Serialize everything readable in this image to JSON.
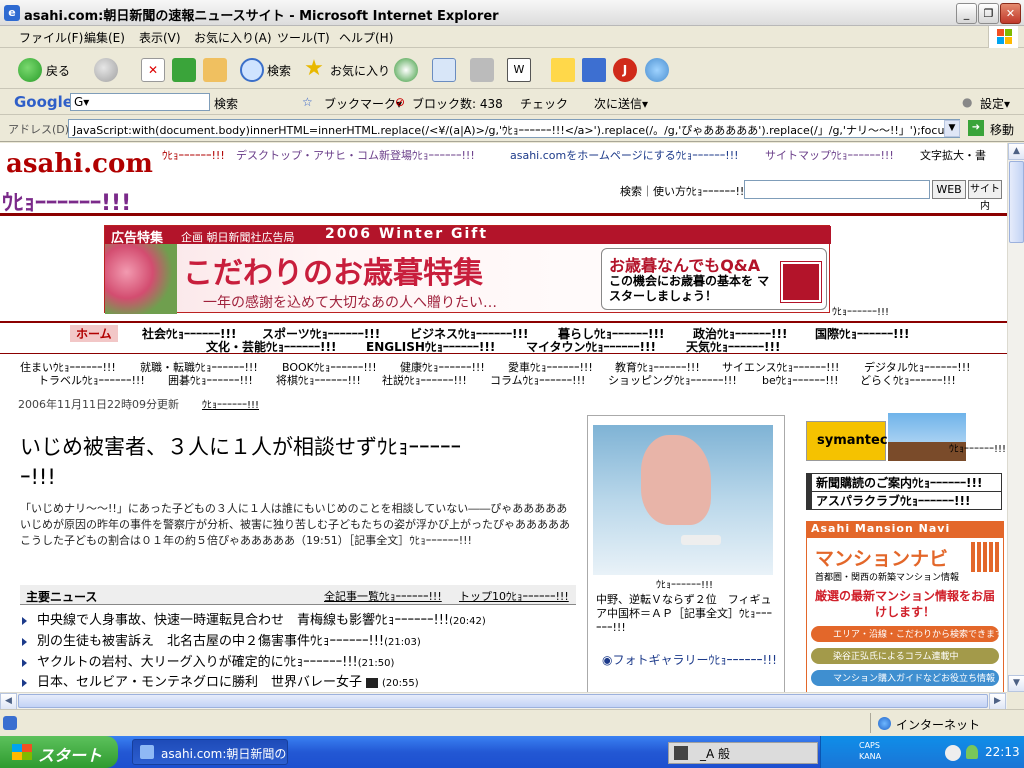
{
  "window": {
    "title": "asahi.com:朝日新聞の速報ニュースサイト - Microsoft Internet Explorer",
    "buttons": {
      "minimize": "_",
      "restore": "❐",
      "close": "✕"
    }
  },
  "menu": [
    "ファイル(F)",
    "編集(E)",
    "表示(V)",
    "お気に入り(A)",
    "ツール(T)",
    "ヘルプ(H)"
  ],
  "toolbar": {
    "back": "戻る",
    "search": "検索",
    "favorites": "お気に入り"
  },
  "google": {
    "logo": "Google",
    "input": "G▾",
    "search": "検索",
    "bookmark": "ブックマーク▾",
    "block": "ブロック数: 438",
    "check": "チェック",
    "send": "次に送信▾",
    "settings": "設定▾"
  },
  "address": {
    "label": "アドレス(D)",
    "url": "JavaScript:with(document.body)innerHTML=innerHTML.replace(/<¥/(a|A)>/g,'ｳﾋｮｰｰｰｰｰｰ!!!</a>').replace(/。/g,'ぴゃあああああ').replace(/」/g,'ナリ～～!!」');focus()",
    "go": "移動"
  },
  "site": {
    "logo": "asahi.com",
    "tagline": "ｳﾋｮｰｰｰｰｰｰ!!!",
    "topnav": [
      "ｳﾋｮｰｰｰｰｰｰ!!!",
      "デスクトップ・アサヒ・コム新登場ｳﾋｮｰｰｰｰｰｰ!!!",
      "asahi.comをホームページにするｳﾋｮｰｰｰｰｰｰ!!!",
      "サイトマップｳﾋｮｰｰｰｰｰｰ!!!",
      "文字拡大・書"
    ],
    "search_label": "検索｜使い方ｳﾋｮｰｰｰｰｰｰ!!!",
    "web_btn": "WEB",
    "site_btn": "サイト内",
    "banner": {
      "tag": "広告特集",
      "plan": "企画 朝日新聞社広告局",
      "event": "2006 Winter Gift",
      "headline": "こだわりのお歳暮特集",
      "sub": "一年の感謝を込めて大切なあの人へ贈りたい…",
      "qa_title": "お歳暮なんでもQ&A",
      "qa_text": "この機会にお歳暮の基本を マスターしましょう！",
      "caption": "ｳﾋｮｰｰｰｰｰｰ!!!"
    },
    "cats_row1": [
      "ホーム",
      "社会ｳﾋｮｰｰｰｰｰｰ!!!",
      "スポーツｳﾋｮｰｰｰｰｰｰ!!!",
      "ビジネスｳﾋｮｰｰｰｰｰｰ!!!",
      "暮らしｳﾋｮｰｰｰｰｰｰ!!!",
      "政治ｳﾋｮｰｰｰｰｰｰ!!!",
      "国際ｳﾋｮｰｰｰｰｰｰ!!!"
    ],
    "cats_row2": [
      "文化・芸能ｳﾋｮｰｰｰｰｰｰ!!!",
      "ENGLISHｳﾋｮｰｰｰｰｰｰ!!!",
      "マイタウンｳﾋｮｰｰｰｰｰｰ!!!",
      "天気ｳﾋｮｰｰｰｰｰｰ!!!"
    ],
    "subcats_row1": [
      "住まいｳﾋｮｰｰｰｰｰｰ!!!",
      "就職・転職ｳﾋｮｰｰｰｰｰｰ!!!",
      "BOOKｳﾋｮｰｰｰｰｰｰ!!!",
      "健康ｳﾋｮｰｰｰｰｰｰ!!!",
      "愛車ｳﾋｮｰｰｰｰｰｰ!!!",
      "教育ｳﾋｮｰｰｰｰｰｰ!!!",
      "サイエンスｳﾋｮｰｰｰｰｰｰ!!!",
      "デジタルｳﾋｮｰｰｰｰｰｰ!!!"
    ],
    "subcats_row2": [
      "トラベルｳﾋｮｰｰｰｰｰｰ!!!",
      "囲碁ｳﾋｮｰｰｰｰｰｰ!!!",
      "将棋ｳﾋｮｰｰｰｰｰｰ!!!",
      "社説ｳﾋｮｰｰｰｰｰｰ!!!",
      "コラムｳﾋｮｰｰｰｰｰｰ!!!",
      "ショッピングｳﾋｮｰｰｰｰｰｰ!!!",
      "beｳﾋｮｰｰｰｰｰｰ!!!",
      "どらくｳﾋｮｰｰｰｰｰｰ!!!"
    ],
    "updated": "2006年11月11日22時09分更新",
    "updated_link": "ｳﾋｮｰｰｰｰｰｰ!!!",
    "headline_l1": "いじめ被害者、３人に１人が相談せずｳﾋｮｰｰｰｰｰ",
    "headline_l2": "ｰ!!!",
    "lead": "「いじめナリ～～!!」にあった子どもの３人に１人は誰にもいじめのことを相談していない――ぴゃあああああいじめが原因の昨年の事件を警察庁が分析、被害に独り苦しむ子どもたちの姿が浮かび上がったぴゃあああああこうした子どもの割合は０１年の約５倍ぴゃあああああ（19:51）［記事全文］ｳﾋｮｰｰｰｰｰｰ!!!",
    "news_header": "主要ニュース",
    "news_all": "全記事一覧ｳﾋｮｰｰｰｰｰｰ!!!",
    "news_top10": "トップ10ｳﾋｮｰｰｰｰｰｰ!!!",
    "news": [
      {
        "title": "中央線で人身事故、快速一時運転見合わせ　青梅線も影響ｳﾋｮｰｰｰｰｰｰ!!!",
        "time": "(20:42)"
      },
      {
        "title": "別の生徒も被害訴え　北名古屋の中２傷害事件ｳﾋｮｰｰｰｰｰｰ!!!",
        "time": "(21:03)"
      },
      {
        "title": "ヤクルトの岩村、大リーグ入りが確定的にｳﾋｮｰｰｰｰｰｰ!!!",
        "time": "(21:50)"
      },
      {
        "title": "日本、セルビア・モンテネグロに勝利　世界バレー女子",
        "time": "(20:55)"
      }
    ],
    "photo_caption_top": "ｳﾋｮｰｰｰｰｰｰ!!!",
    "photo_caption": "中野、逆転Ｖならず２位　フィギュア中国杯＝ＡＰ［記事全文］ｳﾋｮｰｰｰｰｰｰ!!!",
    "photo_gallery": "フォトギャラリーｳﾋｮｰｰｰｰｰｰ!!!",
    "ad_symantec": "symantec.",
    "ad_side_caption": "ｳﾋｮｰｰｰｰｰｰ!!!",
    "side_links": [
      "新聞購読のご案内ｳﾋｮｰｰｰｰｰｰ!!!",
      "アスパラクラブｳﾋｮｰｰｰｰｰｰ!!!"
    ],
    "mansion": {
      "header": "Asahi Mansion Navi",
      "title": "マンションナビ",
      "subtitle": "首都圏・関西の新築マンション情報",
      "pitch": "厳選の最新マンション情報をお届けします！",
      "b1": "エリア・沿線・こだわりから検索できます",
      "b2": "染谷正弘氏によるコラム連載中",
      "b3": "マンション購入ガイドなどお役立ち情報"
    }
  },
  "status": {
    "zone": "インターネット"
  },
  "taskbar": {
    "start": "スタート",
    "item": "asahi.com:朝日新聞の...",
    "ime": "_A 般",
    "caps": "CAPS KANA",
    "clock": "22:13"
  }
}
